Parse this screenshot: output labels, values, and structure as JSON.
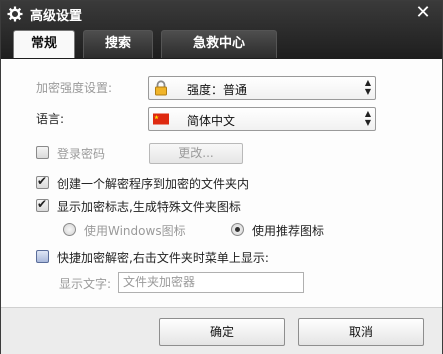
{
  "window": {
    "title": "高级设置",
    "close_glyph": "✕"
  },
  "tabs": [
    {
      "label": "常规",
      "active": true
    },
    {
      "label": "搜索",
      "active": false
    },
    {
      "label": "急救中心",
      "active": false
    }
  ],
  "encryption": {
    "label": "加密强度设置:",
    "value": "强度：普通",
    "icon": "lock-icon",
    "enabled": false
  },
  "language": {
    "label": "语言:",
    "value": "简体中文",
    "icon": "china-flag-icon"
  },
  "login_password": {
    "label": "登录密码",
    "checked": false,
    "enabled": false,
    "change_button": "更改..."
  },
  "options": [
    {
      "label": "创建一个解密程序到加密的文件夹内",
      "checked": true
    },
    {
      "label": "显示加密标志,生成特殊文件夹图标",
      "checked": true
    }
  ],
  "icon_choice": {
    "windows_label": "使用Windows图标",
    "windows_selected": false,
    "recommended_label": "使用推荐图标",
    "recommended_selected": true
  },
  "quick_encrypt": {
    "label": "快捷加密解密,右击文件夹时菜单上显示:",
    "checked": false,
    "display_text_label": "显示文字:",
    "display_text_placeholder": "文件夹加密器"
  },
  "footer": {
    "ok_label": "确定",
    "cancel_label": "取消"
  },
  "colors": {
    "titlebar": "#2a2a2a",
    "disabled_text": "#9a9a9a",
    "footer_bg": "#ececec"
  }
}
